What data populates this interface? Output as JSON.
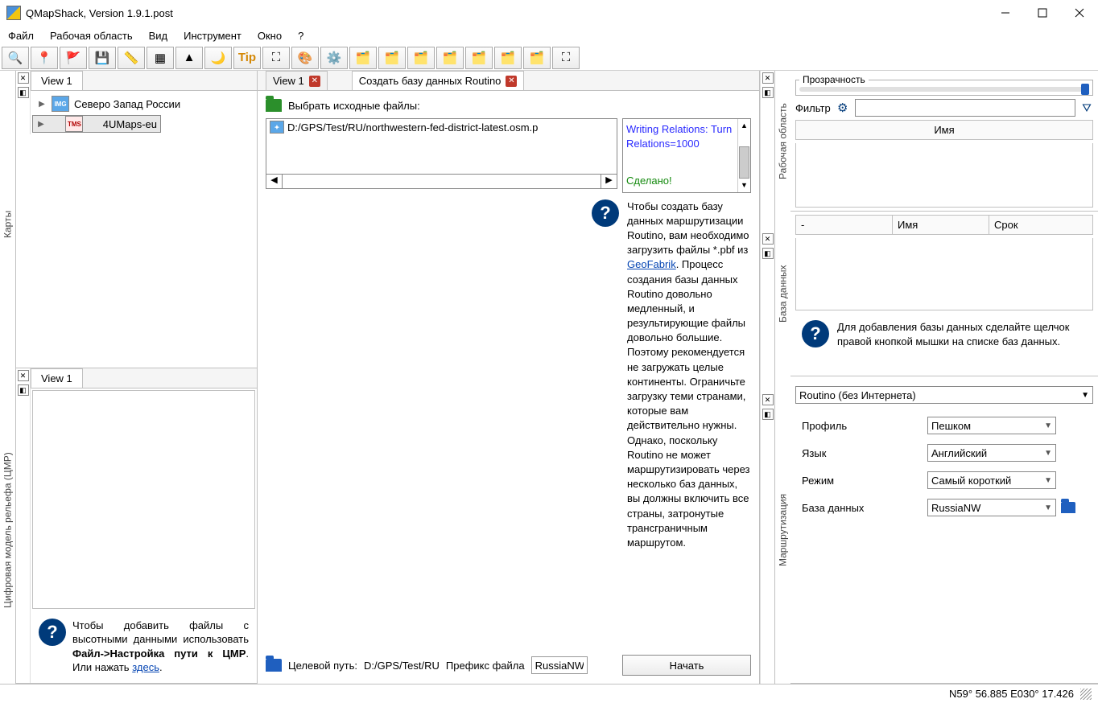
{
  "title": "QMapShack, Version 1.9.1.post",
  "menu": {
    "file": "Файл",
    "workspace": "Рабочая область",
    "view": "Вид",
    "tool": "Инструмент",
    "window": "Окно",
    "help": "?"
  },
  "left": {
    "maps_tab": "Карты",
    "dem_tab": "Цифровая модель рельефа (ЦМР)",
    "view_tab": "View 1",
    "items": [
      {
        "label": "Северо Запад России",
        "badge": "IMG",
        "bg": "#5ba7e8",
        "fg": "#fff"
      },
      {
        "label": "4UMaps-eu",
        "badge": "TMS",
        "bg": "#ffe9e9",
        "fg": "#b00000"
      }
    ],
    "dem_view_tab": "View 1",
    "hint_pre": "Чтобы добавить файлы с высотными данными использовать ",
    "hint_bold": "Файл->Настройка пути к ЦМР",
    "hint_mid": ". Или нажать ",
    "hint_link": "здесь"
  },
  "center": {
    "tab1": "View 1",
    "tab2": "Создать базу данных Routino",
    "select_src": "Выбрать исходные файлы:",
    "file": "D:/GPS/Test/RU/northwestern-fed-district-latest.osm.p",
    "log1": "Writing Relations: Turn Relations=1000",
    "log2": "Сделано!",
    "info_pre": "Чтобы создать базу данных маршрутизации Routino, вам необходимо загрузить файлы *.pbf из ",
    "info_link": "GeoFabrik",
    "info_post": ". Процесс создания базы данных Routino довольно медленный, и результирующие файлы довольно большие. Поэтому рекомендуется не загружать целые континенты. Ограничьте загрузку теми странами, которые вам действительно нужны. Однако, поскольку Routino не может маршрутизировать через несколько баз данных, вы должны включить все страны, затронутые трансграничным маршрутом.",
    "target_label": "Целевой путь:",
    "target_val": "D:/GPS/Test/RU",
    "prefix_label": "Префикс файла",
    "prefix_val": "RussiaNW",
    "start": "Начать"
  },
  "right": {
    "workspace_tab": "Рабочая область",
    "db_tab": "База данных",
    "routing_tab": "Маршрутизация",
    "transparency": "Прозрачность",
    "filter": "Фильтр",
    "col_name": "Имя",
    "col_dash": "-",
    "col_name2": "Имя",
    "col_term": "Срок",
    "db_hint": "Для добавления базы данных сделайте щелчок правой кнопкой мышки на списке баз данных.",
    "router": "Routino (без Интернета)",
    "profile_l": "Профиль",
    "profile_v": "Пешком",
    "lang_l": "Язык",
    "lang_v": "Английский",
    "mode_l": "Режим",
    "mode_v": "Самый короткий",
    "dbase_l": "База данных",
    "dbase_v": "RussiaNW"
  },
  "status": "N59° 56.885 E030° 17.426"
}
